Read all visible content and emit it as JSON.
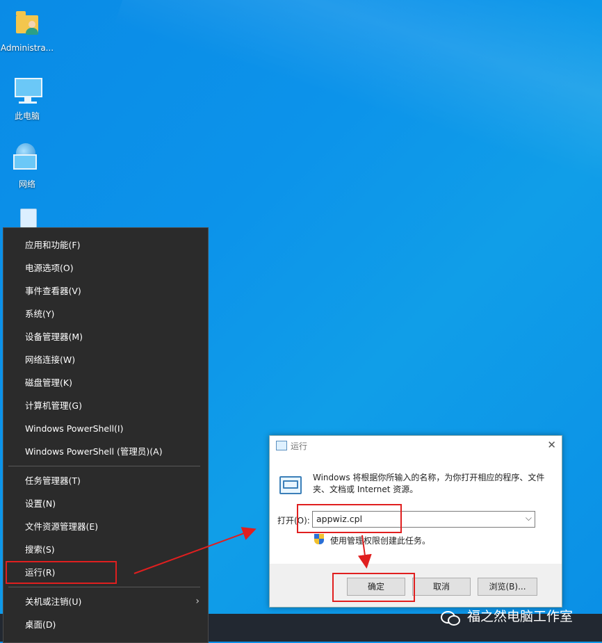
{
  "desktop": {
    "icons": [
      {
        "label": "Administra..."
      },
      {
        "label": "此电脑"
      },
      {
        "label": "网络"
      },
      {
        "label": ""
      }
    ]
  },
  "winx_menu": {
    "items": [
      {
        "label": "应用和功能(F)"
      },
      {
        "label": "电源选项(O)"
      },
      {
        "label": "事件查看器(V)"
      },
      {
        "label": "系统(Y)"
      },
      {
        "label": "设备管理器(M)"
      },
      {
        "label": "网络连接(W)"
      },
      {
        "label": "磁盘管理(K)"
      },
      {
        "label": "计算机管理(G)"
      },
      {
        "label": "Windows PowerShell(I)"
      },
      {
        "label": "Windows PowerShell (管理员)(A)"
      },
      {
        "label": "任务管理器(T)"
      },
      {
        "label": "设置(N)"
      },
      {
        "label": "文件资源管理器(E)"
      },
      {
        "label": "搜索(S)"
      },
      {
        "label": "运行(R)"
      },
      {
        "label": "关机或注销(U)"
      },
      {
        "label": "桌面(D)"
      }
    ],
    "submenu_arrow": "›"
  },
  "run_dialog": {
    "title": "运行",
    "close_glyph": "✕",
    "description": "Windows 将根据你所输入的名称，为你打开相应的程序、文件夹、文档或 Internet 资源。",
    "open_label": "打开(O):",
    "open_value": "appwiz.cpl",
    "dropdown_glyph": "⌵",
    "admin_note": "使用管理权限创建此任务。",
    "buttons": {
      "ok": "确定",
      "cancel": "取消",
      "browse": "浏览(B)..."
    }
  },
  "watermark": "福之然电脑工作室",
  "colors": {
    "highlight": "#e01f1f",
    "menu_bg": "#2b2b2b",
    "desktop": "#0c93ea"
  }
}
